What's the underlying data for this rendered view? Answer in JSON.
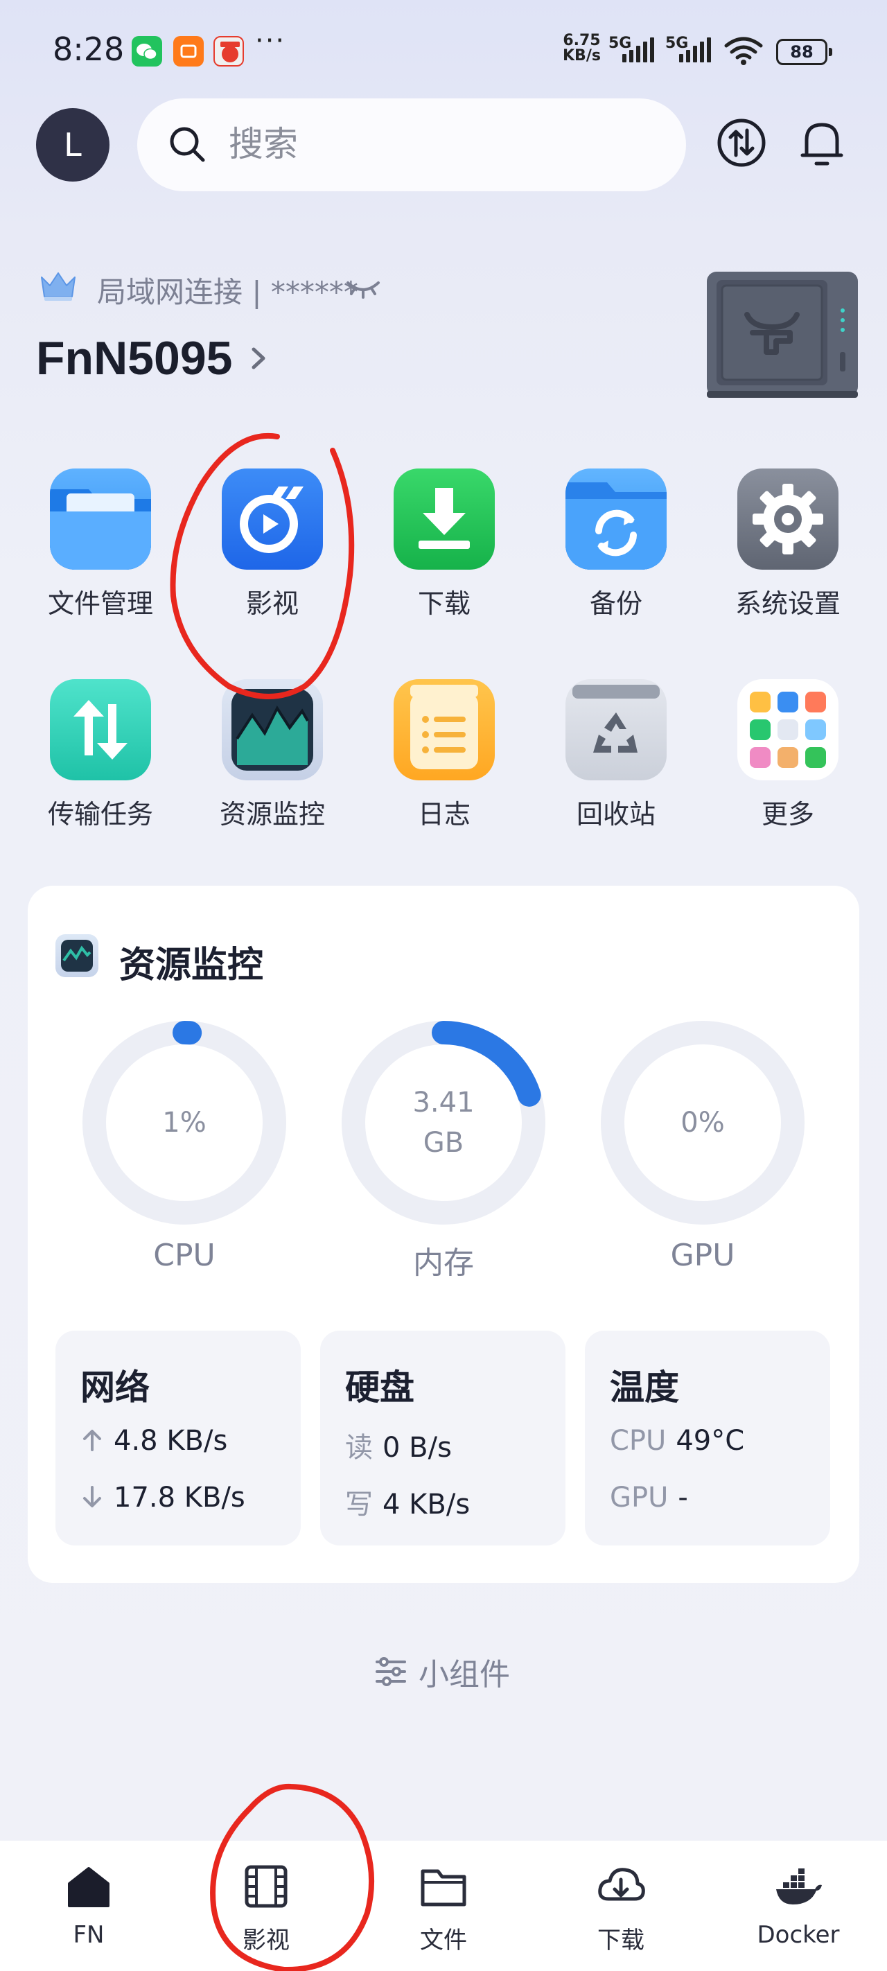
{
  "status_bar": {
    "time": "8:28",
    "dots": "···",
    "net_speed_value": "6.75",
    "net_speed_unit": "KB/s",
    "sim1": "5G",
    "sim2": "5G",
    "battery": "88"
  },
  "search": {
    "placeholder": "搜索"
  },
  "avatar": {
    "initial": "L"
  },
  "device": {
    "connection": "局域网连接 | ******",
    "name": "FnN5095"
  },
  "apps_row1": [
    {
      "label": "文件管理",
      "icon": "folder-icon"
    },
    {
      "label": "影视",
      "icon": "video-icon"
    },
    {
      "label": "下载",
      "icon": "download-icon"
    },
    {
      "label": "备份",
      "icon": "backup-icon"
    },
    {
      "label": "系统设置",
      "icon": "settings-icon"
    }
  ],
  "apps_row2": [
    {
      "label": "传输任务",
      "icon": "transfer-icon"
    },
    {
      "label": "资源监控",
      "icon": "monitor-icon"
    },
    {
      "label": "日志",
      "icon": "log-icon"
    },
    {
      "label": "回收站",
      "icon": "recycle-icon"
    },
    {
      "label": "更多",
      "icon": "more-apps-icon"
    }
  ],
  "monitor": {
    "title": "资源监控",
    "cpu": {
      "label": "CPU",
      "value": "1%",
      "fraction": 0.01
    },
    "memory": {
      "label": "内存",
      "value_num": "3.41",
      "value_unit": "GB",
      "fraction": 0.2
    },
    "gpu": {
      "label": "GPU",
      "value": "0%",
      "fraction": 0.0
    },
    "network": {
      "title": "网络",
      "up": "4.8 KB/s",
      "down": "17.8 KB/s"
    },
    "disk": {
      "title": "硬盘",
      "read_key": "读",
      "read": "0 B/s",
      "write_key": "写",
      "write": "4 KB/s"
    },
    "temperature": {
      "title": "温度",
      "cpu_key": "CPU",
      "cpu": "49°C",
      "gpu_key": "GPU",
      "gpu": "-"
    }
  },
  "widgets_label": "小组件",
  "bottom_nav": [
    {
      "label": "FN",
      "icon": "home-icon"
    },
    {
      "label": "影视",
      "icon": "film-icon"
    },
    {
      "label": "文件",
      "icon": "folder-outline-icon"
    },
    {
      "label": "下载",
      "icon": "cloud-download-icon"
    },
    {
      "label": "Docker",
      "icon": "docker-icon"
    }
  ],
  "colors": {
    "accent": "#2b78e4",
    "annotation": "#e8271e",
    "gauge_track": "#eceef5"
  }
}
